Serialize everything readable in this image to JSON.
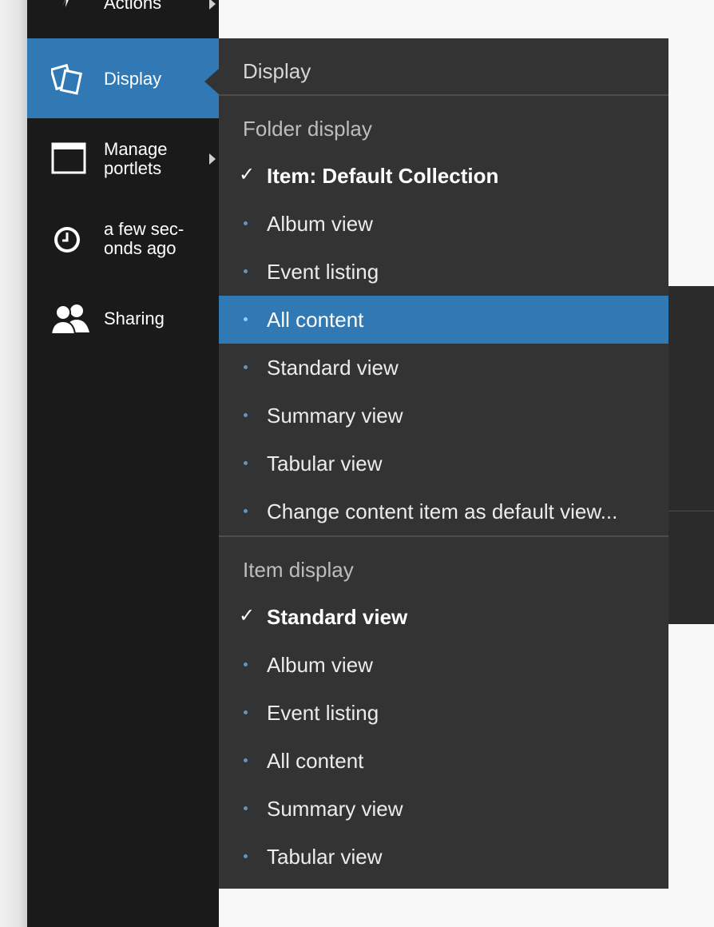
{
  "sidebar": {
    "items": [
      {
        "name": "Actions",
        "icon": "lightning-icon",
        "has_submenu": true
      },
      {
        "name": "Display",
        "icon": "display-icon",
        "active": true
      },
      {
        "name_line1": "Manage",
        "name_line2": "portlets",
        "icon": "window-icon",
        "has_submenu": true
      },
      {
        "name_line1": "a few sec-",
        "name_line2": "onds ago",
        "icon": "clock-icon"
      },
      {
        "name": "Sharing",
        "icon": "users-icon"
      }
    ]
  },
  "menu": {
    "title": "Display",
    "folder_display": {
      "label": "Folder display",
      "items": [
        {
          "label": "Item: Default Collection",
          "selected": true
        },
        {
          "label": "Album view"
        },
        {
          "label": "Event listing"
        },
        {
          "label": "All content",
          "highlighted": true
        },
        {
          "label": "Standard view"
        },
        {
          "label": "Summary view"
        },
        {
          "label": "Tabular view"
        },
        {
          "label": "Change content item as default view..."
        }
      ]
    },
    "item_display": {
      "label": "Item display",
      "items": [
        {
          "label": "Standard view",
          "selected": true
        },
        {
          "label": "Album view"
        },
        {
          "label": "Event listing"
        },
        {
          "label": "All content"
        },
        {
          "label": "Summary view"
        },
        {
          "label": "Tabular view"
        }
      ]
    }
  },
  "icons": {
    "check": "✓"
  },
  "colors": {
    "sidebar_bg": "#1a1a1a",
    "accent": "#3079b4",
    "menu_bg": "#333333",
    "bullet": "#5599d0"
  }
}
